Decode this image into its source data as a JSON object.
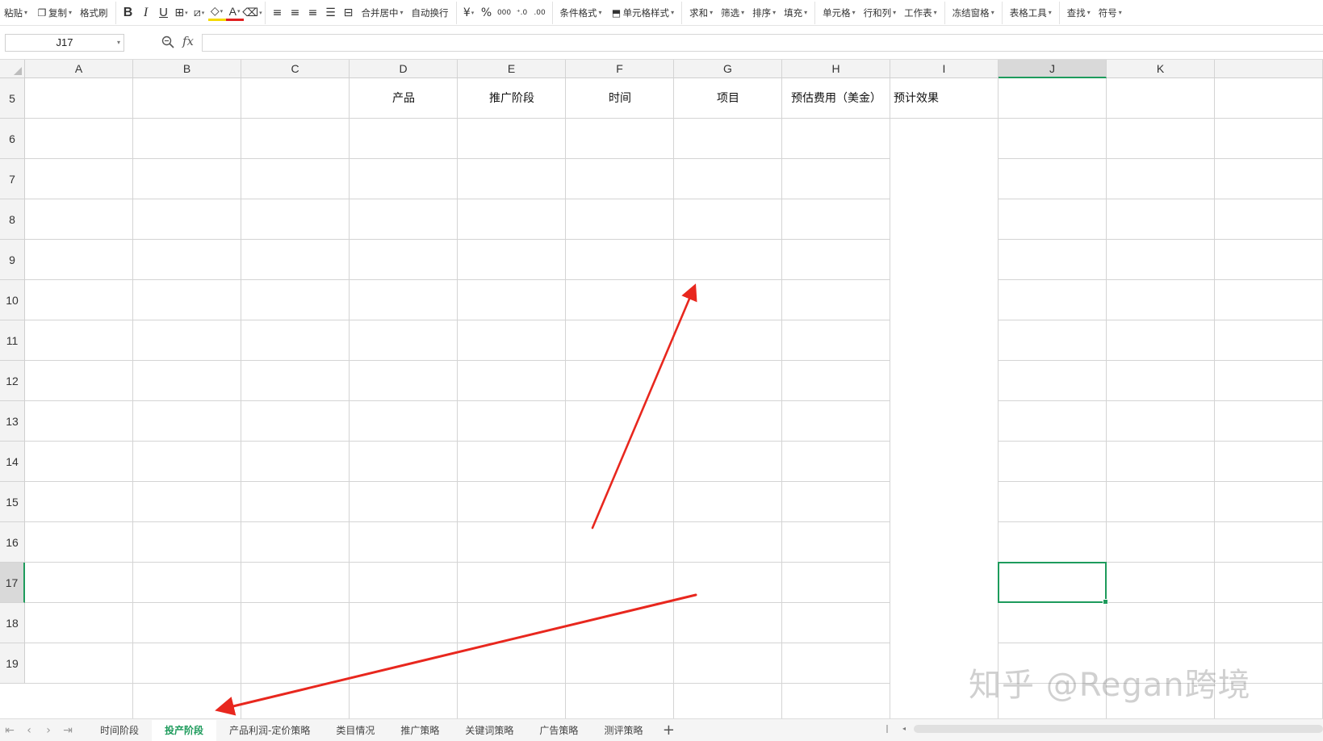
{
  "ribbon": {
    "paste": "粘贴",
    "copy": "复制",
    "format_painter": "格式刷",
    "merge_center": "合并居中",
    "wrap_text": "自动换行",
    "currency_symbol": "¥",
    "percent_symbol": "%",
    "thousands_symbol": "000",
    "conditional_format": "条件格式",
    "cell_style": "单元格样式",
    "sum": "求和",
    "filter": "筛选",
    "sort": "排序",
    "fill": "填充",
    "cell": "单元格",
    "row_col": "行和列",
    "worksheet": "工作表",
    "freeze": "冻结窗格",
    "table_tools": "表格工具",
    "find": "查找",
    "symbol": "符号"
  },
  "formula_bar": {
    "name_box": "J17",
    "fx": "fx",
    "value": ""
  },
  "columns": [
    "A",
    "B",
    "C",
    "D",
    "E",
    "F",
    "G",
    "H",
    "I",
    "J",
    "K"
  ],
  "rows": [
    "5",
    "6",
    "7",
    "8",
    "9",
    "10",
    "11",
    "12",
    "13",
    "14",
    "15",
    "16",
    "17",
    "18",
    "19"
  ],
  "header_cells": {
    "D5": "产品",
    "E5": "推广阶段",
    "F5": "时间",
    "G5": "项目",
    "H5": "预估费用（美金）",
    "I5": "预计效果"
  },
  "selection": {
    "cell": "J17",
    "column": "J",
    "row": "17"
  },
  "sheet_tabs": [
    "时间阶段",
    "投产阶段",
    "产品利润-定价策略",
    "类目情况",
    "推广策略",
    "关键词策略",
    "广告策略",
    "测评策略"
  ],
  "active_tab": "投产阶段",
  "watermark": "知乎 @Regan跨境",
  "colors": {
    "accent": "#1e9b5c",
    "arrow": "#e8271e",
    "grid": "#d4d4d4"
  }
}
